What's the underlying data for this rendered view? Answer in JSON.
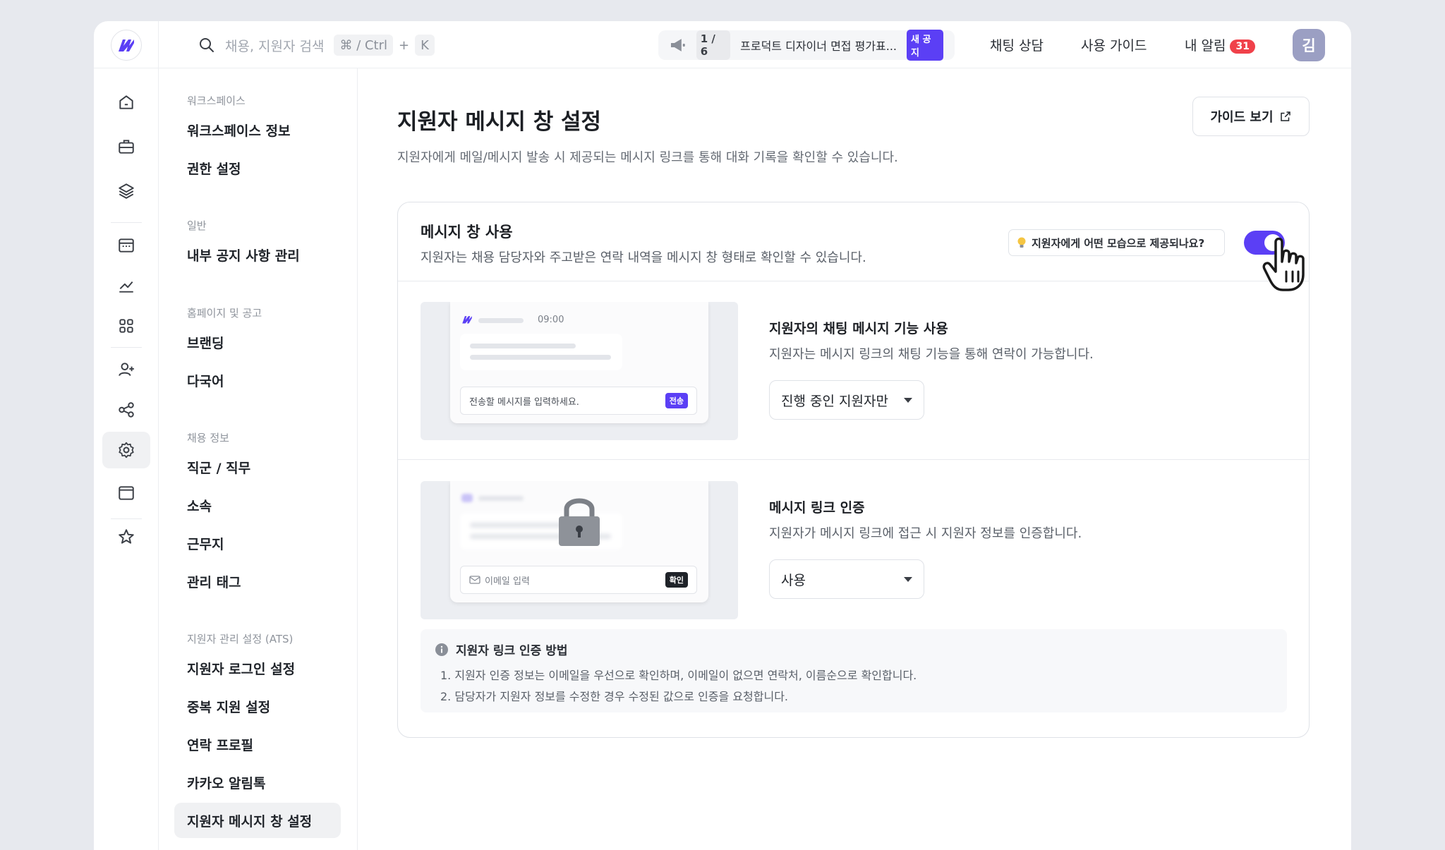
{
  "topbar": {
    "search_placeholder": "채용, 지원자 검색",
    "shortcut_cmd": "⌘ / Ctrl",
    "shortcut_plus": "+",
    "shortcut_key": "K",
    "notice_count": "1 / 6",
    "notice_text": "프로덕트 디자이너 면접 평가표...",
    "notice_badge": "새 공지",
    "chat_link": "채팅 상담",
    "guide_link": "사용 가이드",
    "alarm_label": "내 알림",
    "alarm_count": "31",
    "avatar_initial": "김"
  },
  "rail": {
    "icons": [
      "home-icon",
      "briefcase-icon",
      "layers-icon",
      "calendar-icon",
      "chart-icon",
      "apps-icon",
      "user-add-icon",
      "share-icon",
      "gear-icon",
      "window-icon",
      "star-icon"
    ],
    "active": "gear-icon"
  },
  "subnav": {
    "groups": [
      {
        "label": "워크스페이스",
        "items": [
          "워크스페이스 정보",
          "권한 설정"
        ]
      },
      {
        "label": "일반",
        "items": [
          "내부 공지 사항 관리"
        ]
      },
      {
        "label": "홈페이지 및 공고",
        "items": [
          "브랜딩",
          "다국어"
        ]
      },
      {
        "label": "채용 정보",
        "items": [
          "직군 / 직무",
          "소속",
          "근무지",
          "관리 태그"
        ]
      },
      {
        "label": "지원자 관리 설정 (ATS)",
        "items": [
          "지원자 로그인 설정",
          "중복 지원 설정",
          "연락 프로필",
          "카카오 알림톡",
          "지원자 메시지 창 설정"
        ]
      }
    ],
    "active_item": "지원자 메시지 창 설정"
  },
  "page": {
    "title": "지원자 메시지 창 설정",
    "description": "지원자에게 메일/메시지 발송 시 제공되는 메시지 링크를 통해 대화 기록을 확인할 수 있습니다.",
    "guide_button": "가이드 보기"
  },
  "card": {
    "title": "메시지 창 사용",
    "description": "지원자는 채용 담당자와 주고받은 연락 내역을 메시지 창 형태로 확인할 수 있습니다.",
    "hint_button": "지원자에게 어떤 모습으로 제공되나요?",
    "toggle_on": true,
    "accent": "#5b3ff5"
  },
  "chat_feature": {
    "preview_time": "09:00",
    "preview_input": "전송할 메시지를 입력하세요.",
    "preview_send": "전송",
    "title": "지원자의 채팅 메시지 기능 사용",
    "description": "지원자는 메시지 링크의 채팅 기능을 통해 연락이 가능합니다.",
    "select_value": "진행 중인 지원자만"
  },
  "auth_feature": {
    "preview_input": "이메일 입력",
    "preview_confirm": "확인",
    "title": "메시지 링크 인증",
    "description": "지원자가 메시지 링크에 접근 시 지원자 정보를 인증합니다.",
    "select_value": "사용"
  },
  "info": {
    "title": "지원자 링크 인증 방법",
    "lines": [
      "1. 지원자 인증 정보는 이메일을 우선으로 확인하며, 이메일이 없으면 연락처, 이름순으로 확인합니다.",
      "2. 담당자가 지원자 정보를 수정한 경우 수정된 값으로 인증을 요청합니다."
    ]
  }
}
